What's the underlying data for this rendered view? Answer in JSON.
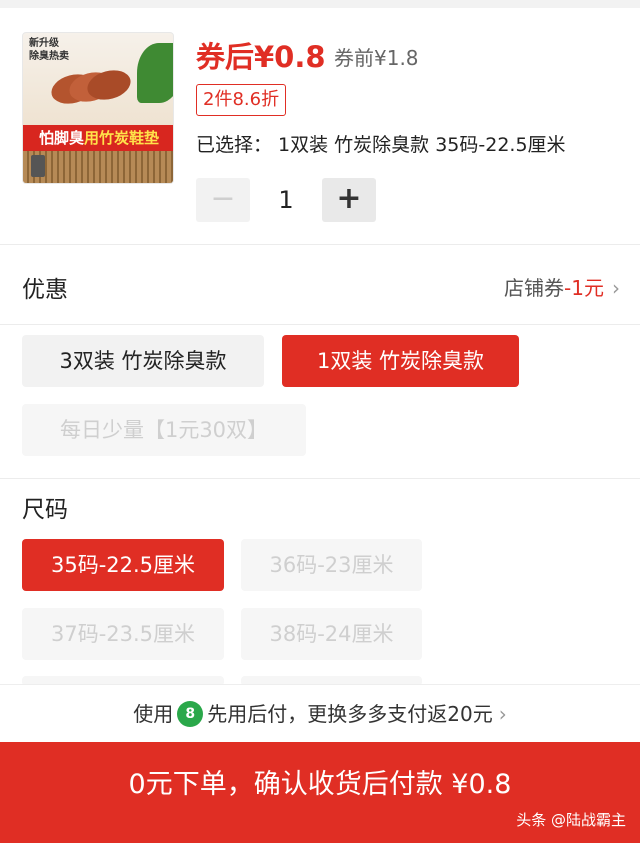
{
  "product": {
    "thumb_tag_line1": "新升级",
    "thumb_tag_line2": "除臭热卖",
    "thumb_banner_a": "怕脚臭",
    "thumb_banner_b": "用竹炭鞋垫",
    "price_after": "券后¥0.8",
    "price_before": "券前¥1.8",
    "discount_badge": "2件8.6折",
    "selected_text": "已选择： 1双装 竹炭除臭款 35码-22.5厘米"
  },
  "stepper": {
    "minus": "−",
    "quantity": "1",
    "plus": "+"
  },
  "promo": {
    "title": "优惠",
    "coupon_prefix": "店铺券",
    "coupon_amount": "-1元",
    "chevron": "›"
  },
  "variants": {
    "options": [
      {
        "label": "3双装  竹炭除臭款",
        "state": "normal"
      },
      {
        "label": "1双装 竹炭除臭款",
        "state": "selected"
      },
      {
        "label": "每日少量【1元30双】",
        "state": "disabled"
      }
    ]
  },
  "size": {
    "title": "尺码",
    "options": [
      {
        "label": "35码-22.5厘米",
        "state": "selected"
      },
      {
        "label": "36码-23厘米",
        "state": "disabled"
      },
      {
        "label": "37码-23.5厘米",
        "state": "disabled"
      },
      {
        "label": "38码-24厘米",
        "state": "disabled"
      }
    ]
  },
  "bnpl": {
    "prefix": "使用",
    "icon_glyph": "8",
    "text": "先用后付，更换多多支付返20元",
    "chevron": "›"
  },
  "footer": {
    "cta": "0元下单，确认收货后付款 ¥0.8",
    "watermark": "头条 @陆战霸主"
  },
  "colors": {
    "accent": "#e02e24",
    "bnpl_green": "#2aa84a"
  }
}
